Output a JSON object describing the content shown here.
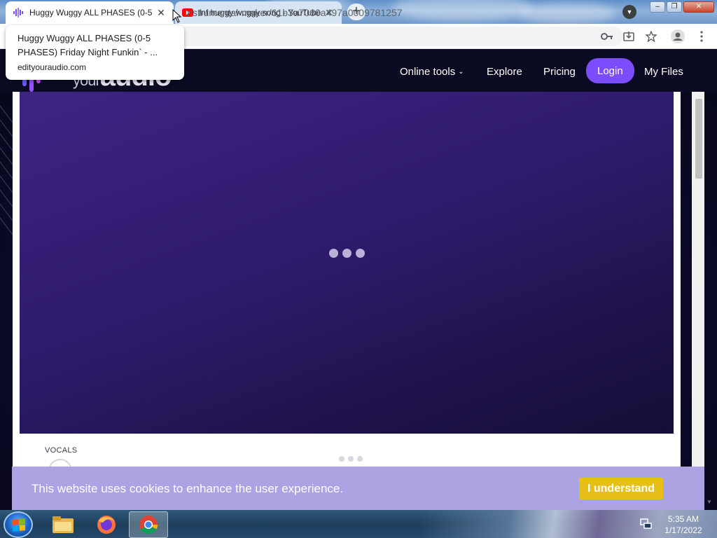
{
  "browser": {
    "tabs": [
      {
        "title": "Huggy Wuggy ALL PHASES (0-5",
        "active": true,
        "icon": "audio-wave-icon"
      },
      {
        "title": "fnf huggy wuggy song - YouTube",
        "active": false,
        "icon": "youtube-icon"
      }
    ],
    "new_tab_label": "+",
    "url": "instrumental-maker/61b3a7060a497a0009781257",
    "tooltip": {
      "title": "Huggy Wuggy ALL PHASES (0-5 PHASES) Friday Night Funkin` - ...",
      "domain": "edityouraudio.com"
    },
    "window_controls": {
      "minimize": "–",
      "restore": "❐",
      "close": "✕"
    }
  },
  "site": {
    "logo_small": "your",
    "logo_big": "audio",
    "nav": {
      "online_tools": "Online tools",
      "explore": "Explore",
      "pricing": "Pricing",
      "login": "Login",
      "my_files": "My Files"
    },
    "track_label": "VOCALS",
    "colors": {
      "accent": "#7c4dff",
      "cookie_bg": "#aba3e2",
      "cookie_button": "#e6c019",
      "player_bg": "#2e1b6d"
    }
  },
  "cookie": {
    "message": "This website uses cookies to enhance the user experience.",
    "button": "I understand"
  },
  "taskbar": {
    "apps": [
      "start-orb",
      "file-explorer",
      "firefox",
      "chrome"
    ],
    "active_app": "chrome",
    "time": "5:35 AM",
    "date": "1/17/2022"
  }
}
